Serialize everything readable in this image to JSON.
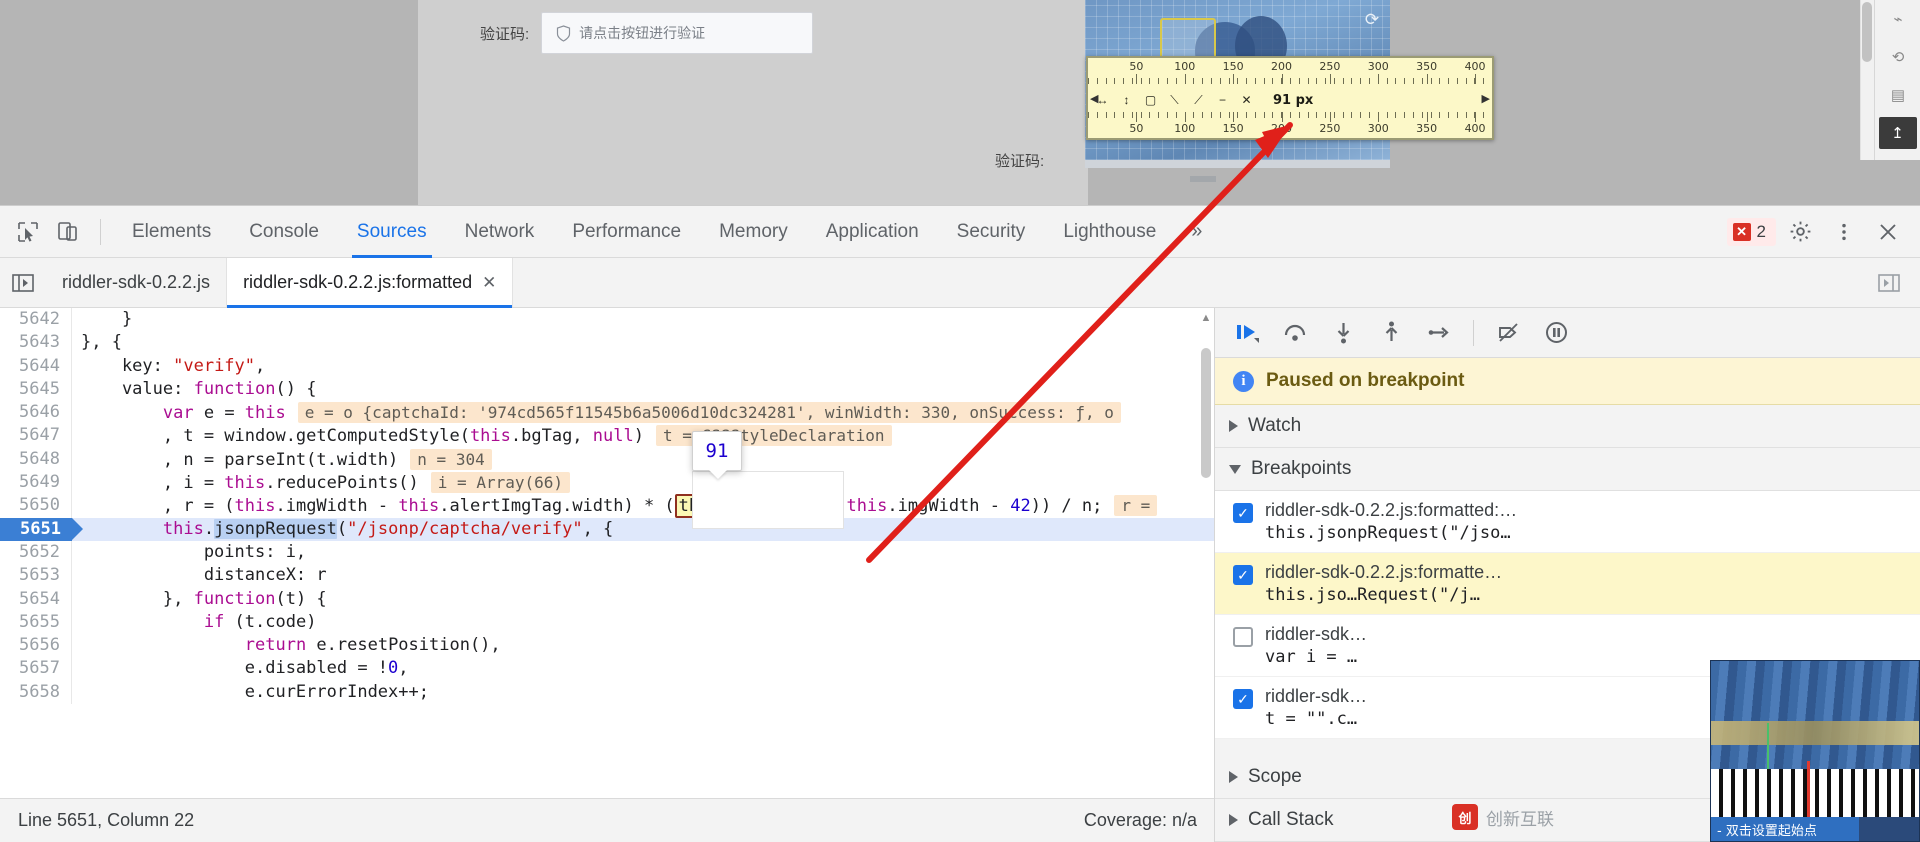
{
  "page": {
    "captcha_label_1": "验证码:",
    "captcha_label_2": "验证码:",
    "captcha_placeholder": "请点击按钮进行验证",
    "shield_icon": "shield-icon",
    "reload_icon": "reload-icon"
  },
  "ruler": {
    "top_ticks": [
      "50",
      "100",
      "150",
      "200",
      "250",
      "300",
      "350",
      "400"
    ],
    "bottom_ticks": [
      "50",
      "100",
      "150",
      "200",
      "250",
      "300",
      "350",
      "400"
    ],
    "value": "91 px",
    "tools": [
      "move-icon",
      "resize-vertical-icon",
      "rect-icon",
      "diagonal-icon",
      "line-icon",
      "minus-icon",
      "close-icon"
    ],
    "left_arrow": "◀",
    "right_arrow": "▶"
  },
  "side_toolbar": {
    "items": [
      "share-icon",
      "history-icon",
      "clipboard-icon",
      "upload-icon"
    ]
  },
  "devtools": {
    "inspect_icon": "inspect-cursor-icon",
    "device_icon": "device-toolbar-icon",
    "tabs": [
      {
        "label": "Elements",
        "active": false
      },
      {
        "label": "Console",
        "active": false
      },
      {
        "label": "Sources",
        "active": true
      },
      {
        "label": "Network",
        "active": false
      },
      {
        "label": "Performance",
        "active": false
      },
      {
        "label": "Memory",
        "active": false
      },
      {
        "label": "Application",
        "active": false
      },
      {
        "label": "Security",
        "active": false
      },
      {
        "label": "Lighthouse",
        "active": false
      }
    ],
    "more_tabs": "»",
    "error_count": "2",
    "error_mark": "✕",
    "settings_icon": "gear-icon",
    "menu_icon": "kebab-menu-icon",
    "close_icon": "close-icon"
  },
  "file_tabs": {
    "nav_icon": "show-navigator-icon",
    "items": [
      {
        "label": "riddler-sdk-0.2.2.js",
        "active": false,
        "closable": false
      },
      {
        "label": "riddler-sdk-0.2.2.js:formatted",
        "active": true,
        "closable": true
      }
    ],
    "close_glyph": "✕",
    "right_icon": "show-debugger-icon"
  },
  "editor": {
    "lines": [
      {
        "num": "5642",
        "current": false,
        "tokens": [
          {
            "t": "    }",
            "c": "plain"
          }
        ]
      },
      {
        "num": "5643",
        "current": false,
        "tokens": [
          {
            "t": "}, {",
            "c": "plain"
          }
        ]
      },
      {
        "num": "5644",
        "current": false,
        "tokens": [
          {
            "t": "    key: ",
            "c": "plain"
          },
          {
            "t": "\"verify\"",
            "c": "str"
          },
          {
            "t": ",",
            "c": "plain"
          }
        ]
      },
      {
        "num": "5645",
        "current": false,
        "tokens": [
          {
            "t": "    value: ",
            "c": "plain"
          },
          {
            "t": "function",
            "c": "fn"
          },
          {
            "t": "() {",
            "c": "plain"
          }
        ]
      },
      {
        "num": "5646",
        "current": false,
        "tokens": [
          {
            "t": "        ",
            "c": "plain"
          },
          {
            "t": "var",
            "c": "kw2"
          },
          {
            "t": " e = ",
            "c": "plain"
          },
          {
            "t": "this",
            "c": "kw2"
          }
        ],
        "inline": "e = o {captchaId: '974cd565f11545b6a5006d10dc324281', winWidth: 330, onSuccess: ƒ, o"
      },
      {
        "num": "5647",
        "current": false,
        "tokens": [
          {
            "t": "        , t = window.getComputedStyle(",
            "c": "plain"
          },
          {
            "t": "this",
            "c": "kw2"
          },
          {
            "t": ".bgTag, ",
            "c": "plain"
          },
          {
            "t": "null",
            "c": "kw2"
          },
          {
            "t": ")",
            "c": "plain"
          }
        ],
        "inline": "t = CSSStyleDeclaration"
      },
      {
        "num": "5648",
        "current": false,
        "tokens": [
          {
            "t": "        , n = parseInt(t.width)",
            "c": "plain"
          }
        ],
        "inline": "n = 304"
      },
      {
        "num": "5649",
        "current": false,
        "tokens": [
          {
            "t": "        , i = ",
            "c": "plain"
          },
          {
            "t": "this",
            "c": "kw2"
          },
          {
            "t": ".reducePoints()",
            "c": "plain"
          }
        ],
        "inline": "i = Array(66)"
      },
      {
        "num": "5650",
        "current": false,
        "tokens": [
          {
            "t": "        , r = (",
            "c": "plain"
          },
          {
            "t": "this",
            "c": "kw2"
          },
          {
            "t": ".imgWidth - ",
            "c": "plain"
          },
          {
            "t": "this",
            "c": "kw2"
          },
          {
            "t": ".alertImgTag.width) * (",
            "c": "plain"
          },
          {
            "t": "this.offsetX",
            "c": "hl"
          },
          {
            "t": " / (",
            "c": "plain"
          },
          {
            "t": "this",
            "c": "kw2"
          },
          {
            "t": ".imgWidth - ",
            "c": "plain"
          },
          {
            "t": "42",
            "c": "num"
          },
          {
            "t": ")) / n;",
            "c": "plain"
          }
        ],
        "inline": "r ="
      },
      {
        "num": "5651",
        "current": true,
        "tokens": [
          {
            "t": "        ",
            "c": "plain"
          },
          {
            "t": "this",
            "c": "kw2"
          },
          {
            "t": ".",
            "c": "plain"
          },
          {
            "t": "jsonpRequest",
            "c": "sel"
          },
          {
            "t": "(",
            "c": "plain"
          },
          {
            "t": "\"/jsonp/captcha/verify\"",
            "c": "str"
          },
          {
            "t": ", {",
            "c": "plain"
          }
        ]
      },
      {
        "num": "5652",
        "current": false,
        "tokens": [
          {
            "t": "            points: i,",
            "c": "plain"
          }
        ]
      },
      {
        "num": "5653",
        "current": false,
        "tokens": [
          {
            "t": "            distanceX: r",
            "c": "plain"
          }
        ]
      },
      {
        "num": "5654",
        "current": false,
        "tokens": [
          {
            "t": "        }, ",
            "c": "plain"
          },
          {
            "t": "function",
            "c": "fn"
          },
          {
            "t": "(t) {",
            "c": "plain"
          }
        ]
      },
      {
        "num": "5655",
        "current": false,
        "tokens": [
          {
            "t": "            ",
            "c": "plain"
          },
          {
            "t": "if",
            "c": "kw2"
          },
          {
            "t": " (t.code)",
            "c": "plain"
          }
        ]
      },
      {
        "num": "5656",
        "current": false,
        "tokens": [
          {
            "t": "                ",
            "c": "plain"
          },
          {
            "t": "return",
            "c": "kw2"
          },
          {
            "t": " e.resetPosition(),",
            "c": "plain"
          }
        ]
      },
      {
        "num": "5657",
        "current": false,
        "tokens": [
          {
            "t": "                e.disabled = !",
            "c": "plain"
          },
          {
            "t": "0",
            "c": "num"
          },
          {
            "t": ",",
            "c": "plain"
          }
        ]
      },
      {
        "num": "5658",
        "current": false,
        "tokens": [
          {
            "t": "                e.curErrorIndex++;",
            "c": "plain"
          }
        ]
      }
    ],
    "tooltip_value": "91",
    "status_left": "Line 5651, Column 22",
    "status_right": "Coverage: n/a"
  },
  "debugger": {
    "buttons": [
      "resume-icon",
      "step-over-icon",
      "step-into-icon",
      "step-out-icon",
      "step-icon",
      "deactivate-breakpoints-icon",
      "pause-on-exceptions-icon"
    ],
    "paused_text": "Paused on breakpoint",
    "info_glyph": "i",
    "sections": [
      {
        "label": "Watch",
        "expanded": false
      },
      {
        "label": "Breakpoints",
        "expanded": true
      },
      {
        "label": "Scope",
        "expanded": false
      },
      {
        "label": "Call Stack",
        "expanded": false
      }
    ],
    "breakpoints": [
      {
        "checked": true,
        "highlight": false,
        "title": "riddler-sdk-0.2.2.js:formatted:…",
        "code": "this.jsonpRequest(\"/jso…"
      },
      {
        "checked": true,
        "highlight": true,
        "title": "riddler-sdk-0.2.2.js:formatte…",
        "code": "this.jso…Request(\"/j…"
      },
      {
        "checked": false,
        "highlight": false,
        "title": "riddler-sdk…",
        "code": "var i = …"
      },
      {
        "checked": true,
        "highlight": false,
        "title": "riddler-sdk…",
        "code": "t = \"\".c…"
      }
    ],
    "check_glyph": "✓"
  },
  "thumbnail": {
    "footer_text": "- 双击设置起始点"
  },
  "watermark": {
    "logo_text": "创",
    "text": "创新互联"
  },
  "colors": {
    "accent_blue": "#1a73e8",
    "current_line_bg": "#dfe8fb",
    "inline_value_bg": "#fce6cd",
    "paused_banner_bg": "#fdf5d4",
    "breakpoint_hl": "#fdf7c9",
    "error_red": "#d93025",
    "annotation_red": "#e0201a",
    "ruler_bg": "#fcf8c8"
  }
}
